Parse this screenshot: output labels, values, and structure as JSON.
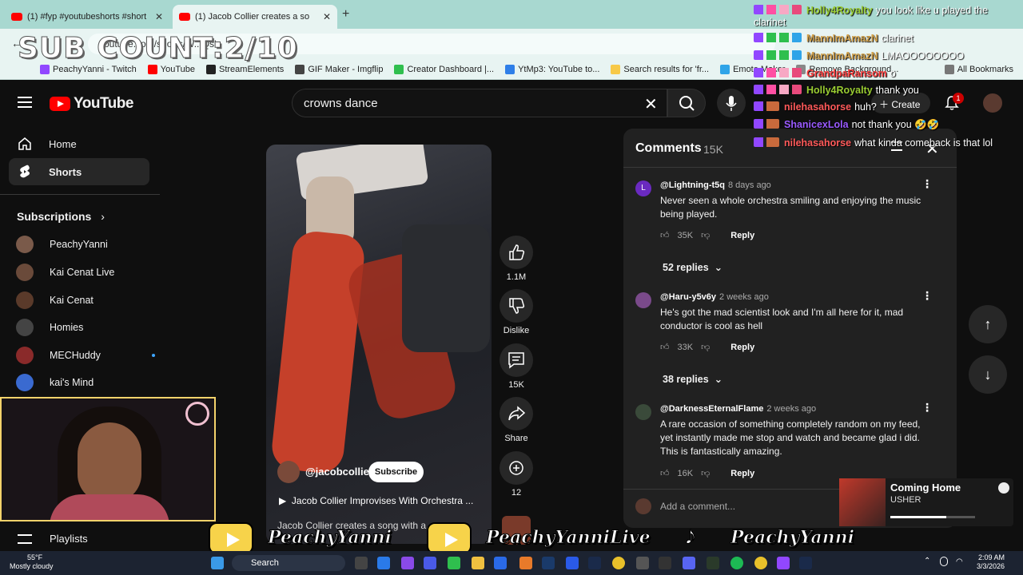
{
  "browser": {
    "tabs": [
      {
        "title": "(1) #fyp #youtubeshorts #short"
      },
      {
        "title": "(1) Jacob Collier creates a so"
      }
    ],
    "url": "youtube.com/shorts/W...Qsl",
    "bookmarks": [
      "PeachyYanni - Twitch",
      "YouTube",
      "StreamElements",
      "GIF Maker - Imgflip",
      "Creator Dashboard |...",
      "YtMp3: YouTube to...",
      "Search results for 'fr...",
      "Emote Maker",
      "Remove Background...",
      "All Bookmarks"
    ]
  },
  "overlay": {
    "sub_count": "SUB COUNT:2/10"
  },
  "youtube": {
    "logo_text": "YouTube",
    "search_value": "crowns dance",
    "create_label": "Create",
    "notification_count": "1"
  },
  "sidebar": {
    "items": [
      {
        "label": "Home",
        "icon": "home-icon"
      },
      {
        "label": "Shorts",
        "icon": "shorts-icon"
      }
    ],
    "subscriptions_title": "Subscriptions",
    "channels": [
      {
        "label": "PeachyYanni",
        "color": "#7a5a4a"
      },
      {
        "label": "Kai Cenat Live",
        "color": "#6a4a3a"
      },
      {
        "label": "Kai Cenat",
        "color": "#5a3a2a"
      },
      {
        "label": "Homies",
        "color": "#444444"
      },
      {
        "label": "MECHuddy",
        "color": "#8a2a2a"
      },
      {
        "label": "kai's Mind",
        "color": "#3a6ad0"
      }
    ],
    "playlists_label": "Playlists"
  },
  "video": {
    "channel": "@jacobcollier",
    "subscribe_label": "Subscribe",
    "song_title": "Jacob Collier Improvises With Orchestra ...",
    "description": "Jacob Collier creates a song with a...",
    "actions": {
      "likes": "1.1M",
      "dislike_label": "Dislike",
      "comments": "15K",
      "share_label": "Share",
      "remix": "12"
    }
  },
  "comments": {
    "title": "Comments",
    "count": "15K",
    "items": [
      {
        "user": "@Lightning-t5q",
        "time": "8 days ago",
        "text": "Never seen a whole orchestra smiling and enjoying the music being played.",
        "likes": "35K",
        "replies": "52 replies",
        "avatar_color": "#6a2ac0",
        "initial": "L"
      },
      {
        "user": "@Haru-y5v6y",
        "time": "2 weeks ago",
        "text": "He's got the mad scientist look and I'm all here for it, mad conductor is cool as hell",
        "likes": "33K",
        "replies": "38 replies",
        "avatar_color": "#7a4a8a",
        "initial": ""
      },
      {
        "user": "@DarknessEternalFlame",
        "time": "2 weeks ago",
        "text": "A rare occasion of something completely random on my feed, yet instantly made me stop and watch and became glad i did. This is fantastically amazing.",
        "likes": "16K",
        "replies": "",
        "avatar_color": "#3a4a3a",
        "initial": ""
      }
    ],
    "reply_label": "Reply",
    "add_placeholder": "Add a comment..."
  },
  "chat": [
    {
      "user": "Holly4Royalty",
      "msg": "you look like u played the",
      "color": "#9acd32"
    },
    {
      "user": "",
      "msg": "clarinet",
      "color": "#9acd32"
    },
    {
      "user": "MannImAmazN",
      "msg": "clarinet",
      "color": "#d2a24c"
    },
    {
      "user": "MannImAmazN",
      "msg": "LMAOOOOOOOO",
      "color": "#d2a24c"
    },
    {
      "user": "GrandpaRansom",
      "msg": "o",
      "color": "#ff4040"
    },
    {
      "user": "Holly4Royalty",
      "msg": "thank you",
      "color": "#9acd32"
    },
    {
      "user": "nilehasahorse",
      "msg": "huh?",
      "color": "#ff5a5a"
    },
    {
      "user": "ShanicexLola",
      "msg": "not thank you 🤣🤣",
      "color": "#9a5aff"
    },
    {
      "user": "nilehasahorse",
      "msg": "what kinda comeback is that lol",
      "color": "#ff5a5a"
    }
  ],
  "now_playing": {
    "title": "Coming Home",
    "artist": "USHER",
    "progress": 0.66
  },
  "socials": {
    "youtube1": "PeachyYanni",
    "youtube2": "PeachyYanniLive",
    "tiktok": "PeachyYanni"
  },
  "taskbar": {
    "temp": "55°F",
    "weather": "Mostly cloudy",
    "search_label": "Search",
    "time": "2:09 AM",
    "date": "3/3/2026"
  }
}
